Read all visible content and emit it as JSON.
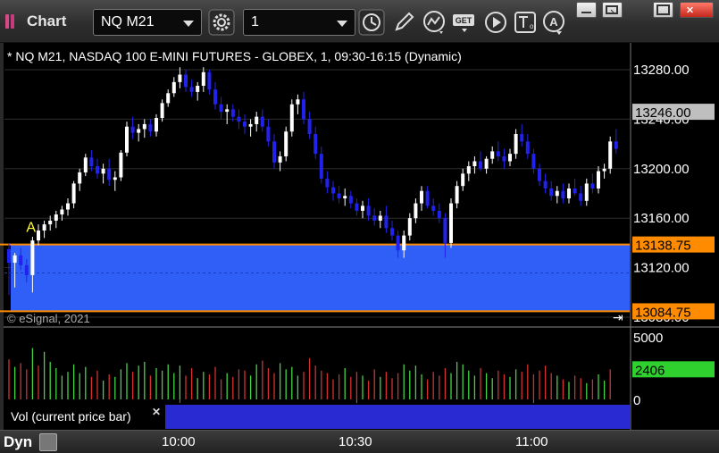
{
  "window": {
    "title": "Chart",
    "symbol": "NQ M21",
    "interval": "1"
  },
  "toolbar": {
    "icons": [
      "settings-gear-icon",
      "clock-icon",
      "pencil-icon",
      "study-line-icon",
      "get-icon",
      "play-icon",
      "text-tool-icon",
      "alert-icon"
    ],
    "window_buttons": [
      "minimize-icon",
      "restore-icon",
      "maximize-icon",
      "close-icon"
    ]
  },
  "chart_header": "* NQ M21, NASDAQ 100 E-MINI FUTURES - GLOBEX, 1, 09:30-16:15 (Dynamic)",
  "copyright": "© eSignal, 2021",
  "colors": {
    "up": "#ffffff",
    "down": "#2222ee",
    "zone_fill": "#2f5ff7",
    "zone_line": "#ff8c00",
    "last_price_tag": "#bfbfbf",
    "volume_tag": "#2ed12e",
    "vol_up": "#44d444",
    "vol_down": "#d43030"
  },
  "chart_data": [
    {
      "type": "candlestick",
      "title": "* NQ M21, NASDAQ 100 E-MINI FUTURES - GLOBEX, 1, 09:30-16:15 (Dynamic)",
      "ylim": [
        13060,
        13300
      ],
      "y_ticks": [
        "13280.00",
        "13240.00",
        "13200.00",
        "13160.00",
        "13120.00",
        "13080.00"
      ],
      "x_ticks": [
        "10:00",
        "10:30",
        "11:00"
      ],
      "x_tick_bars": [
        29,
        59,
        89
      ],
      "last_price": "13246.00",
      "zone": {
        "upper": "13138.75",
        "lower": "13084.75"
      },
      "marker": {
        "label": "A",
        "bar": 4,
        "price": 13149
      },
      "candles": [
        [
          13135,
          13140,
          13098,
          13124
        ],
        [
          13124,
          13132,
          13104,
          13130
        ],
        [
          13130,
          13136,
          13118,
          13122
        ],
        [
          13122,
          13127,
          13108,
          13114
        ],
        [
          13114,
          13145,
          13100,
          13142
        ],
        [
          13142,
          13155,
          13138,
          13150
        ],
        [
          13150,
          13158,
          13144,
          13155
        ],
        [
          13155,
          13162,
          13150,
          13158
        ],
        [
          13158,
          13166,
          13152,
          13163
        ],
        [
          13163,
          13170,
          13158,
          13167
        ],
        [
          13167,
          13176,
          13162,
          13172
        ],
        [
          13172,
          13190,
          13168,
          13188
        ],
        [
          13188,
          13200,
          13182,
          13197
        ],
        [
          13197,
          13212,
          13194,
          13209
        ],
        [
          13209,
          13215,
          13198,
          13202
        ],
        [
          13202,
          13208,
          13192,
          13196
        ],
        [
          13196,
          13204,
          13188,
          13200
        ],
        [
          13200,
          13208,
          13186,
          13191
        ],
        [
          13191,
          13198,
          13182,
          13193
        ],
        [
          13193,
          13215,
          13190,
          13213
        ],
        [
          13213,
          13238,
          13210,
          13234
        ],
        [
          13234,
          13242,
          13224,
          13229
        ],
        [
          13229,
          13236,
          13222,
          13232
        ],
        [
          13232,
          13240,
          13225,
          13236
        ],
        [
          13236,
          13240,
          13226,
          13230
        ],
        [
          13230,
          13244,
          13226,
          13241
        ],
        [
          13241,
          13256,
          13238,
          13253
        ],
        [
          13253,
          13264,
          13250,
          13261
        ],
        [
          13261,
          13274,
          13258,
          13270
        ],
        [
          13270,
          13282,
          13265,
          13276
        ],
        [
          13276,
          13280,
          13262,
          13266
        ],
        [
          13266,
          13272,
          13258,
          13262
        ],
        [
          13262,
          13270,
          13255,
          13267
        ],
        [
          13267,
          13282,
          13262,
          13278
        ],
        [
          13278,
          13280,
          13260,
          13264
        ],
        [
          13264,
          13270,
          13248,
          13252
        ],
        [
          13252,
          13258,
          13240,
          13246
        ],
        [
          13246,
          13252,
          13236,
          13248
        ],
        [
          13248,
          13252,
          13238,
          13242
        ],
        [
          13242,
          13248,
          13232,
          13238
        ],
        [
          13238,
          13244,
          13228,
          13234
        ],
        [
          13234,
          13240,
          13226,
          13236
        ],
        [
          13236,
          13246,
          13230,
          13242
        ],
        [
          13242,
          13248,
          13230,
          13234
        ],
        [
          13234,
          13240,
          13218,
          13222
        ],
        [
          13222,
          13228,
          13200,
          13205
        ],
        [
          13205,
          13214,
          13198,
          13210
        ],
        [
          13210,
          13234,
          13206,
          13230
        ],
        [
          13230,
          13256,
          13226,
          13252
        ],
        [
          13252,
          13260,
          13244,
          13256
        ],
        [
          13256,
          13262,
          13236,
          13240
        ],
        [
          13240,
          13246,
          13224,
          13228
        ],
        [
          13228,
          13234,
          13208,
          13212
        ],
        [
          13212,
          13218,
          13188,
          13192
        ],
        [
          13192,
          13198,
          13180,
          13185
        ],
        [
          13185,
          13190,
          13174,
          13180
        ],
        [
          13180,
          13186,
          13172,
          13176
        ],
        [
          13176,
          13184,
          13170,
          13178
        ],
        [
          13178,
          13182,
          13168,
          13172
        ],
        [
          13172,
          13176,
          13162,
          13166
        ],
        [
          13166,
          13174,
          13160,
          13170
        ],
        [
          13170,
          13176,
          13158,
          13162
        ],
        [
          13162,
          13168,
          13154,
          13158
        ],
        [
          13158,
          13166,
          13152,
          13162
        ],
        [
          13162,
          13170,
          13148,
          13152
        ],
        [
          13152,
          13158,
          13142,
          13146
        ],
        [
          13146,
          13150,
          13128,
          13134
        ],
        [
          13134,
          13150,
          13128,
          13146
        ],
        [
          13146,
          13164,
          13142,
          13160
        ],
        [
          13160,
          13176,
          13156,
          13172
        ],
        [
          13172,
          13186,
          13166,
          13182
        ],
        [
          13182,
          13186,
          13168,
          13170
        ],
        [
          13170,
          13176,
          13162,
          13166
        ],
        [
          13166,
          13172,
          13156,
          13160
        ],
        [
          13160,
          13164,
          13128,
          13140
        ],
        [
          13140,
          13176,
          13136,
          13172
        ],
        [
          13172,
          13190,
          13168,
          13186
        ],
        [
          13186,
          13200,
          13182,
          13196
        ],
        [
          13196,
          13206,
          13190,
          13202
        ],
        [
          13202,
          13210,
          13196,
          13206
        ],
        [
          13206,
          13214,
          13198,
          13200
        ],
        [
          13200,
          13210,
          13196,
          13208
        ],
        [
          13208,
          13218,
          13204,
          13214
        ],
        [
          13214,
          13222,
          13206,
          13210
        ],
        [
          13210,
          13216,
          13200,
          13206
        ],
        [
          13206,
          13216,
          13202,
          13212
        ],
        [
          13212,
          13232,
          13208,
          13228
        ],
        [
          13228,
          13236,
          13218,
          13222
        ],
        [
          13222,
          13228,
          13208,
          13212
        ],
        [
          13212,
          13216,
          13196,
          13200
        ],
        [
          13200,
          13204,
          13186,
          13190
        ],
        [
          13190,
          13196,
          13180,
          13184
        ],
        [
          13184,
          13190,
          13174,
          13178
        ],
        [
          13178,
          13186,
          13172,
          13182
        ],
        [
          13182,
          13188,
          13172,
          13176
        ],
        [
          13176,
          13188,
          13172,
          13184
        ],
        [
          13184,
          13192,
          13178,
          13180
        ],
        [
          13180,
          13186,
          13170,
          13174
        ],
        [
          13174,
          13192,
          13170,
          13188
        ],
        [
          13188,
          13196,
          13180,
          13184
        ],
        [
          13184,
          13202,
          13180,
          13198
        ],
        [
          13198,
          13204,
          13192,
          13200
        ],
        [
          13200,
          13226,
          13196,
          13222
        ],
        [
          13222,
          13232,
          13212,
          13216
        ]
      ]
    },
    {
      "type": "bar",
      "title": "Vol (current price bar)",
      "ylim": [
        0,
        5000
      ],
      "y_ticks": [
        "5000",
        "0"
      ],
      "last_value": "2406",
      "values": [
        3200,
        2600,
        2900,
        2400,
        4100,
        2700,
        3800,
        3000,
        2500,
        1900,
        2200,
        2800,
        2100,
        2600,
        1800,
        2300,
        1500,
        2000,
        1800,
        2400,
        2900,
        2200,
        2700,
        3000,
        1900,
        2500,
        2300,
        2800,
        2100,
        2700,
        1900,
        2500,
        1700,
        2200,
        2000,
        2600,
        1600,
        2100,
        1800,
        2400,
        2300,
        1900,
        2800,
        3100,
        2500,
        2100,
        2900,
        2400,
        2600,
        1900,
        2200,
        3300,
        2700,
        2300,
        2100,
        1600,
        2000,
        2500,
        1800,
        2200,
        1900,
        1500,
        2400,
        1800,
        2200,
        1700,
        2100,
        2800,
        2300,
        2700,
        2000,
        1600,
        2200,
        1900,
        2500,
        2100,
        3000,
        2800,
        2300,
        1900,
        2500,
        2100,
        1700,
        2300,
        2000,
        1800,
        2400,
        2200,
        2800,
        2000,
        2300,
        2700,
        2100,
        1900,
        1600,
        1400,
        1900,
        1700,
        1300,
        1600,
        2000,
        1500,
        2406
      ],
      "up": [
        0,
        1,
        0,
        0,
        1,
        0,
        1,
        1,
        1,
        1,
        1,
        1,
        1,
        1,
        0,
        0,
        1,
        0,
        1,
        1,
        1,
        0,
        1,
        1,
        0,
        1,
        1,
        1,
        1,
        1,
        0,
        0,
        1,
        1,
        0,
        0,
        0,
        1,
        0,
        0,
        0,
        1,
        1,
        0,
        0,
        0,
        1,
        1,
        1,
        1,
        0,
        0,
        0,
        0,
        0,
        0,
        0,
        1,
        0,
        0,
        1,
        0,
        0,
        1,
        0,
        0,
        0,
        1,
        1,
        1,
        1,
        0,
        0,
        0,
        0,
        1,
        1,
        1,
        1,
        1,
        0,
        1,
        1,
        0,
        0,
        1,
        1,
        0,
        0,
        0,
        0,
        0,
        0,
        1,
        0,
        1,
        0,
        0,
        1,
        0,
        1,
        1,
        0
      ]
    }
  ]
}
